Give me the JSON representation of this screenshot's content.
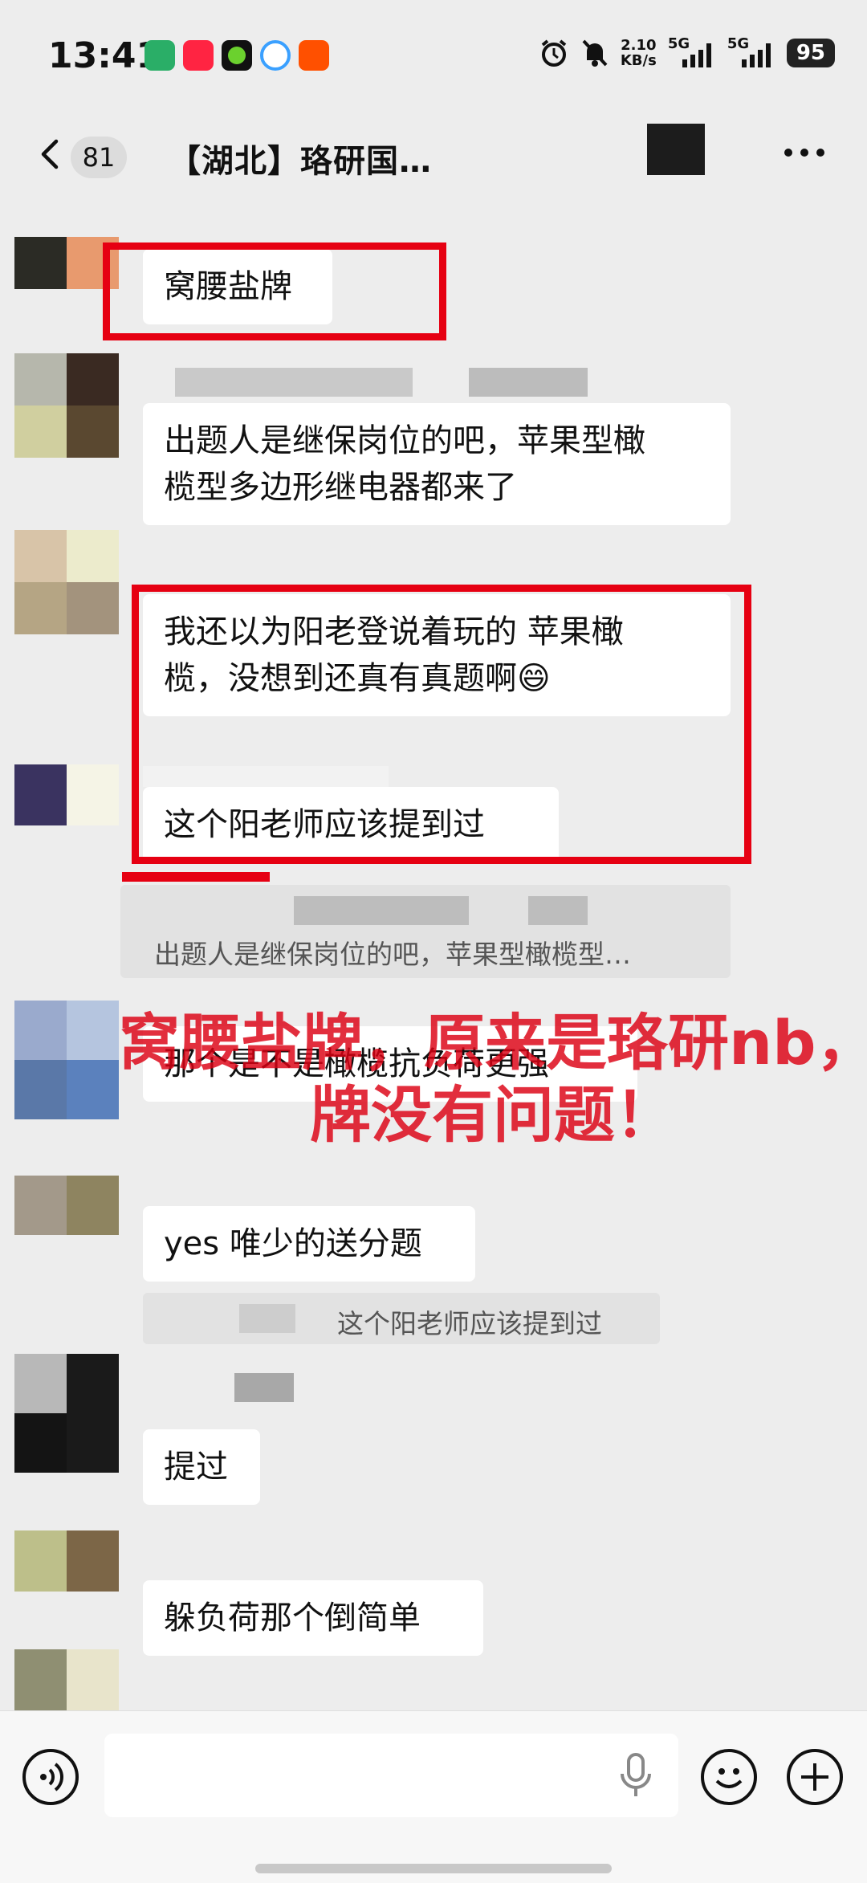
{
  "status_bar": {
    "time": "13:41",
    "net_speed_value": "2.10",
    "net_speed_unit": "KB/s",
    "signal_1": "5G",
    "signal_2": "5G",
    "battery": "95"
  },
  "header": {
    "unread_count": "81",
    "title": "【湖北】珞研国…",
    "more_icon": "more-horizontal-icon"
  },
  "messages": [
    {
      "text": "窝腰盐牌"
    },
    {
      "text": "出题人是继保岗位的吧，苹果型橄\n榄型多边形继电器都来了"
    },
    {
      "text": "我还以为阳老登说着玩的 苹果橄\n榄，没想到还真有真题啊😄"
    },
    {
      "text": "这个阳老师应该提到过"
    },
    {
      "quote": "出题人是继保岗位的吧，苹果型橄榄型…"
    },
    {
      "text": "那个是不是橄榄抗负荷更强"
    },
    {
      "text": "yes 唯少的送分题"
    },
    {
      "quote": "这个阳老师应该提到过"
    },
    {
      "text": "提过"
    },
    {
      "text": "躲负荷那个倒简单"
    }
  ],
  "overlay": {
    "line1": "窝腰盐牌，原来是珞研nb，",
    "line2": "牌没有问题！",
    "color": "#dc0012"
  },
  "input_bar": {
    "voice_icon": "voice-icon",
    "mic_icon": "mic-icon",
    "emoji_icon": "emoji-icon",
    "plus_icon": "plus-icon"
  }
}
